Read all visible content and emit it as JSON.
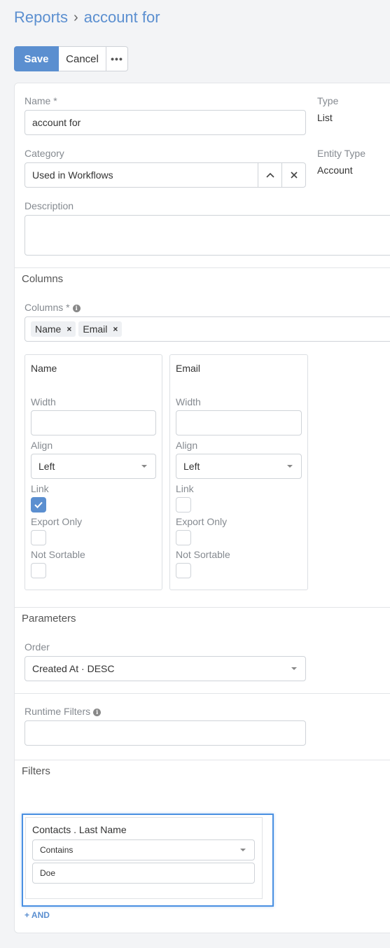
{
  "breadcrumb": {
    "parent": "Reports",
    "separator": "›",
    "current": "account for"
  },
  "toolbar": {
    "save_label": "Save",
    "cancel_label": "Cancel",
    "more_label": "•••"
  },
  "fields": {
    "name": {
      "label": "Name *",
      "value": "account for"
    },
    "type": {
      "label": "Type",
      "value": "List"
    },
    "category": {
      "label": "Category",
      "value": "Used in Workflows"
    },
    "entity_type": {
      "label": "Entity Type",
      "value": "Account"
    },
    "description": {
      "label": "Description",
      "value": ""
    }
  },
  "columns_section": {
    "title": "Columns",
    "field_label": "Columns *",
    "tags": [
      "Name",
      "Email"
    ],
    "cards": [
      {
        "title": "Name",
        "width_label": "Width",
        "width_value": "",
        "align_label": "Align",
        "align_value": "Left",
        "link_label": "Link",
        "link_checked": true,
        "export_only_label": "Export Only",
        "export_only_checked": false,
        "not_sortable_label": "Not Sortable",
        "not_sortable_checked": false
      },
      {
        "title": "Email",
        "width_label": "Width",
        "width_value": "",
        "align_label": "Align",
        "align_value": "Left",
        "link_label": "Link",
        "link_checked": false,
        "export_only_label": "Export Only",
        "export_only_checked": false,
        "not_sortable_label": "Not Sortable",
        "not_sortable_checked": false
      }
    ]
  },
  "parameters_section": {
    "title": "Parameters",
    "order_label": "Order",
    "order_value": "Created At · DESC",
    "runtime_filters_label": "Runtime Filters",
    "runtime_filters_value": ""
  },
  "filters_section": {
    "title": "Filters",
    "filter": {
      "field_label": "Contacts . Last Name",
      "operator": "Contains",
      "value": "Doe"
    },
    "add_and_label": "+ AND"
  },
  "colors": {
    "accent": "#5b8fd0",
    "highlight": "#4a90e2"
  }
}
